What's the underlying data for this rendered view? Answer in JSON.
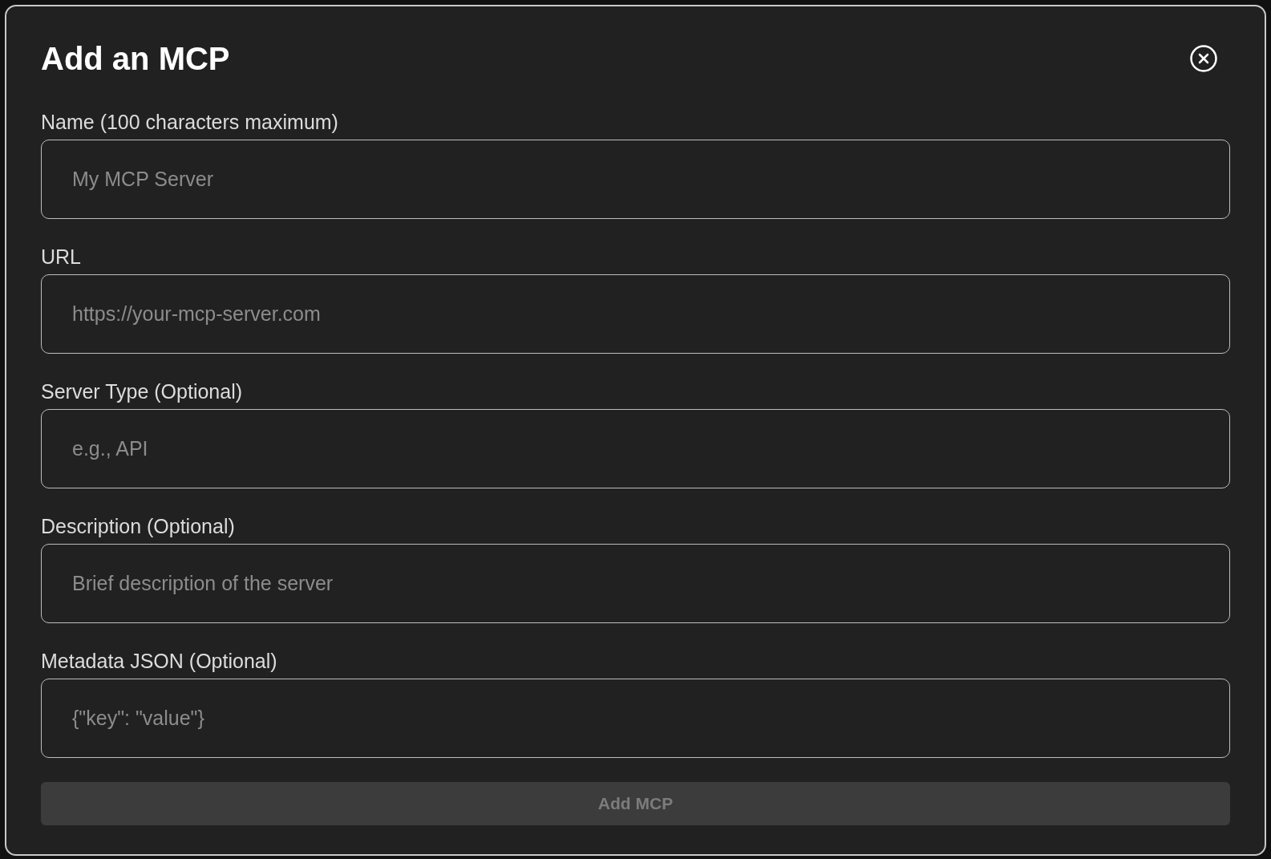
{
  "dialog": {
    "title": "Add an MCP",
    "fields": [
      {
        "label": "Name (100 characters maximum)",
        "placeholder": "My MCP Server"
      },
      {
        "label": "URL",
        "placeholder": "https://your-mcp-server.com"
      },
      {
        "label": "Server Type (Optional)",
        "placeholder": "e.g., API"
      },
      {
        "label": "Description (Optional)",
        "placeholder": "Brief description of the server"
      },
      {
        "label": "Metadata JSON (Optional)",
        "placeholder": "{\"key\": \"value\"}"
      }
    ],
    "submit_button": {
      "label": "Add MCP",
      "disabled": true
    }
  }
}
